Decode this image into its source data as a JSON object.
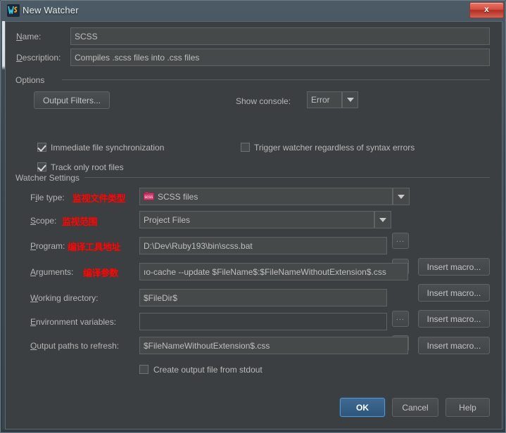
{
  "window": {
    "title": "New Watcher",
    "app_icon": "webstorm-logo-icon",
    "close_label": "x"
  },
  "form": {
    "name_label": "Name:",
    "name_value": "SCSS",
    "description_label": "Description:",
    "description_value": "Compiles .scss files into .css files"
  },
  "options": {
    "group_title": "Options",
    "output_filters_button": "Output Filters...",
    "show_console_label": "Show console:",
    "show_console_value": "Error",
    "checkboxes": [
      {
        "label": "Immediate file synchronization",
        "checked": true
      },
      {
        "label": "Track only root files",
        "checked": true
      },
      {
        "label": "Trigger watcher regardless of syntax errors",
        "checked": false
      }
    ]
  },
  "watcher_settings": {
    "group_title": "Watcher Settings",
    "file_type_label": "File type:",
    "file_type_value": "SCSS files",
    "file_type_icon": "scss-file-icon",
    "file_type_annotation": "监视文件类型",
    "scope_label": "Scope:",
    "scope_value": "Project Files",
    "scope_annotation": "监视范围",
    "program_label": "Program:",
    "program_value": "D:\\Dev\\Ruby193\\bin\\scss.bat",
    "program_annotation": "编译工具地址",
    "arguments_label": "Arguments:",
    "arguments_value": "ıo-cache --update $FileName$:$FileNameWithoutExtension$.css",
    "arguments_annotation": "编译参数",
    "working_directory_label": "Working directory:",
    "working_directory_value": "$FileDir$",
    "environment_variables_label": "Environment variables:",
    "environment_variables_value": "",
    "output_paths_label": "Output paths to refresh:",
    "output_paths_value": "$FileNameWithoutExtension$.css",
    "create_output_checkbox": {
      "label": "Create output file from stdout",
      "checked": false
    },
    "browse_button": "...",
    "insert_macro_button": "Insert macro..."
  },
  "footer": {
    "ok": "OK",
    "cancel": "Cancel",
    "help": "Help"
  }
}
